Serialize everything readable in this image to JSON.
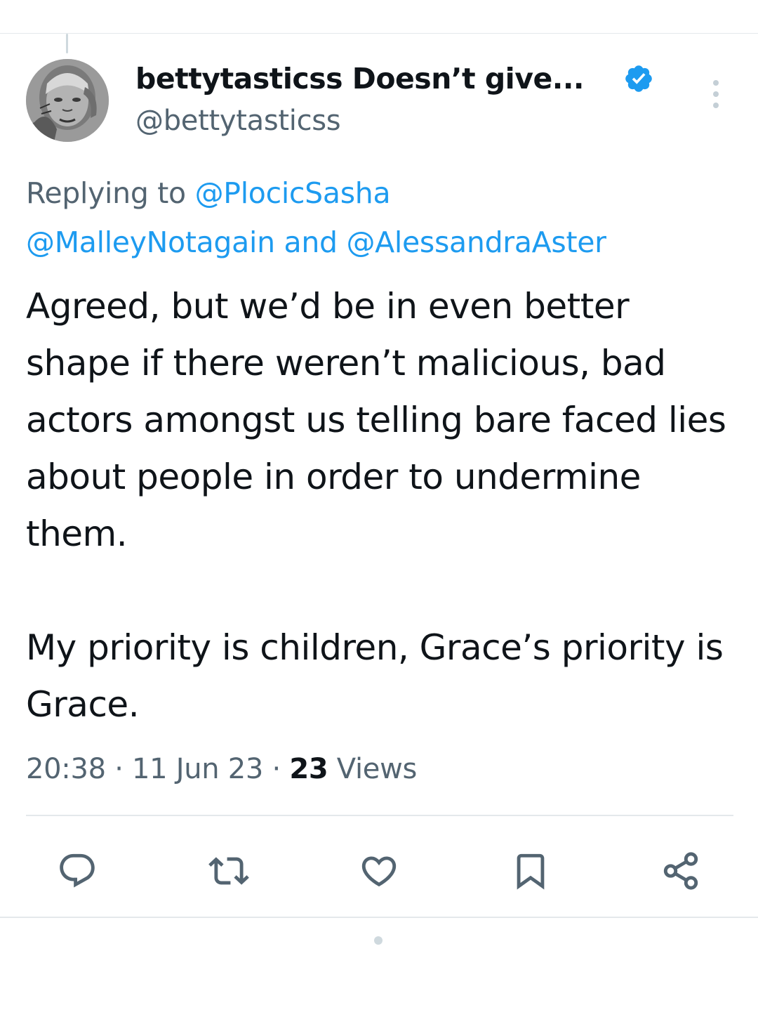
{
  "tweet": {
    "display_name": "bettytasticss Doesn’t give...",
    "handle": "@bettytasticss",
    "replying_prefix": "Replying to ",
    "reply_to_1": "@PlocicSasha",
    "reply_to_2": "@MalleyNotagain",
    "reply_and": " and ",
    "reply_to_3": "@AlessandraAster",
    "text": "Agreed, but we’d be in even better shape if there weren’t malicious, bad actors amongst us telling bare faced lies about people in order to undermine them.\n\nMy priority is children, Grace’s priority is Grace.",
    "time": "20:38",
    "sep": " · ",
    "date": "11 Jun 23",
    "views_count": "23",
    "views_label": " Views"
  },
  "icons": {
    "verified": "verified-badge-icon",
    "more": "more-vertical-icon",
    "reply": "reply-icon",
    "retweet": "retweet-icon",
    "like": "heart-icon",
    "bookmark": "bookmark-icon",
    "share": "share-icon"
  },
  "colors": {
    "accent": "#1d9bf0",
    "secondary_text": "#536471",
    "primary_text": "#0f1419",
    "icon": "#536471"
  }
}
